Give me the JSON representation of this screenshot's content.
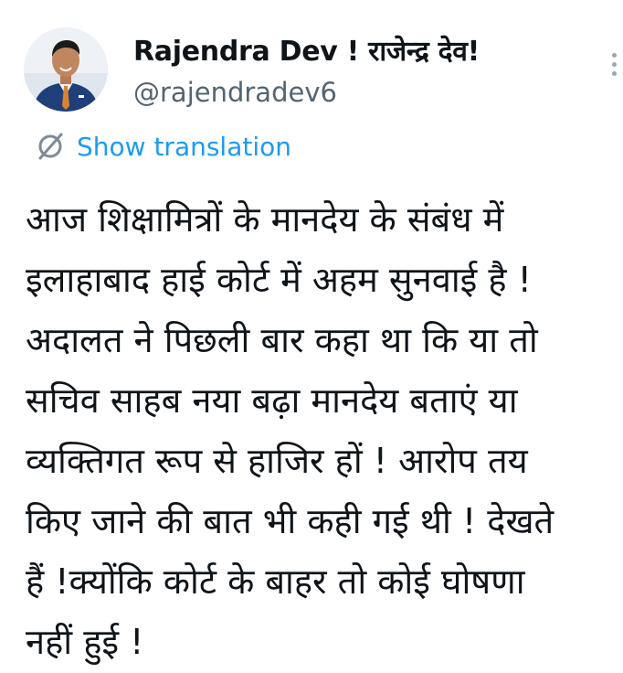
{
  "author": {
    "display_name": "Rajendra Dev ! राजेन्द्र देव!",
    "handle": "@rajendradev6",
    "avatar_icon": "profile-photo"
  },
  "actions": {
    "more_icon": "more-vertical-icon",
    "translate_icon": "translate-icon",
    "translate_label": "Show translation"
  },
  "tweet": {
    "lines": [
      "आज शिक्षामित्रों के मानदेय के संबंध में",
      "इलाहाबाद हाई कोर्ट में अहम सुनवाई है !",
      "अदालत ने पिछली बार कहा था कि या तो",
      "सचिव साहब नया बढ़ा मानदेय बताएं या",
      "व्यक्तिगत रूप से हाजिर  हों ! आरोप तय",
      "किए जाने की बात भी कही गई थी ! देखते",
      "हैं !क्योंकि कोर्ट के बाहर तो कोई घोषणा",
      "नहीं हुई !"
    ]
  },
  "colors": {
    "link": "#1d9bf0",
    "secondary_text": "#536471",
    "primary_text": "#0f1419"
  }
}
